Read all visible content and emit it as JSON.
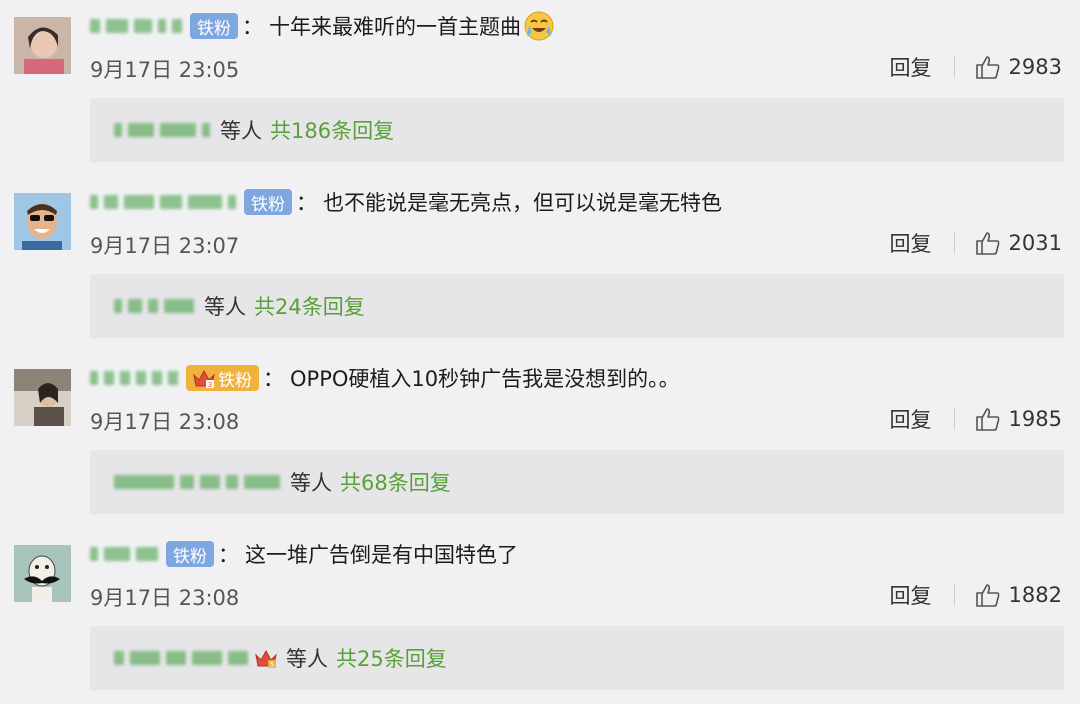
{
  "comments": [
    {
      "badge": "铁粉",
      "badge_style": "blue",
      "text": "十年来最难听的一首主题曲",
      "emoji": "crying-laughing-emoji",
      "time": "9月17日 23:05",
      "reply_label": "回复",
      "likes": "2983",
      "reply_suffix": "等人",
      "reply_count": "共186条回复"
    },
    {
      "badge": "铁粉",
      "badge_style": "blue",
      "text": "也不能说是毫无亮点，但可以说是毫无特色",
      "time": "9月17日 23:07",
      "reply_label": "回复",
      "likes": "2031",
      "reply_suffix": "等人",
      "reply_count": "共24条回复"
    },
    {
      "badge": "铁粉",
      "badge_style": "gold",
      "text": "OPPO硬植入10秒钟广告我是没想到的。。",
      "time": "9月17日 23:08",
      "reply_label": "回复",
      "likes": "1985",
      "reply_suffix": "等人",
      "reply_count": "共68条回复"
    },
    {
      "badge": "铁粉",
      "badge_style": "blue",
      "text": "这一堆广告倒是有中国特色了",
      "time": "9月17日 23:08",
      "reply_label": "回复",
      "likes": "1882",
      "reply_suffix": "等人",
      "reply_count": "共25条回复"
    }
  ],
  "colors": {
    "background": "#f1f1f3",
    "reply_box": "#e6e6e8",
    "reply_count": "#5aa039",
    "badge_blue": "#7ea6e0",
    "badge_gold": "#f0b13d"
  }
}
